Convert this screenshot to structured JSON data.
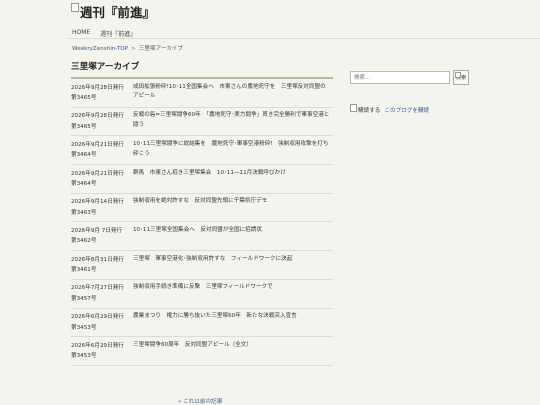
{
  "site": {
    "title": "週刊『前進』"
  },
  "nav": {
    "items": [
      "HOME",
      "週刊『前進』"
    ]
  },
  "breadcrumb": {
    "root": "WeekryZenshin-TOP",
    "separator": ">",
    "current": "三里塚アーカイブ"
  },
  "archive": {
    "title": "三里塚アーカイブ",
    "entries": [
      {
        "date": "2026年9月28日発行",
        "issue": "第3465号",
        "title": "成田拡張粉砕!10･11全国集会へ　市東さんの農地死守を　三里塚反対同盟のアピール"
      },
      {
        "date": "2026年9月28日発行",
        "issue": "第3465号",
        "title": "反戦の砦=三里塚闘争60年　「農地死守･実力闘争」貫き完全勝利で軍事空港と闘う"
      },
      {
        "date": "2026年9月21日発行",
        "issue": "第3464号",
        "title": "10･11三里塚闘争に総結集を　農地死守･軍事空港粉砕!　強制収用攻撃を打ち砕こう"
      },
      {
        "date": "2026年9月21日発行",
        "issue": "第3464号",
        "title": "群馬　市東さん招き三里塚集会　10･11―11月決戦呼びかけ"
      },
      {
        "date": "2026年9月14日発行",
        "issue": "第3463号",
        "title": "強制収用を絶対許すな　反対同盟先頭に千葉県庁デモ"
      },
      {
        "date": "2026年9月 7日発行",
        "issue": "第3462号",
        "title": "10･11三里塚全国集会へ　反対同盟が全国に招請状"
      },
      {
        "date": "2026年8月31日発行",
        "issue": "第3461号",
        "title": "三里塚　軍事空港化･強制収用許すな　フィールドワークに決起"
      },
      {
        "date": "2026年7月27日発行",
        "issue": "第3457号",
        "title": "強制収用手続き準備に反撃　三里塚フィールドワークで"
      },
      {
        "date": "2026年6月29日発行",
        "issue": "第3453号",
        "title": "農業まつり　権力に勝ち抜いた三里塚60年　新たな決戦突入宣言"
      },
      {
        "date": "2026年6月29日発行",
        "issue": "第3453号",
        "title": "三里塚闘争60周年　反対同盟アピール（全文）"
      }
    ],
    "older_link": "« これ以前の記事"
  },
  "sidebar": {
    "search_placeholder": "検索...",
    "search_button": "検索",
    "subscribe_label": "購読する",
    "subscribe_link": "このブログを購読"
  }
}
